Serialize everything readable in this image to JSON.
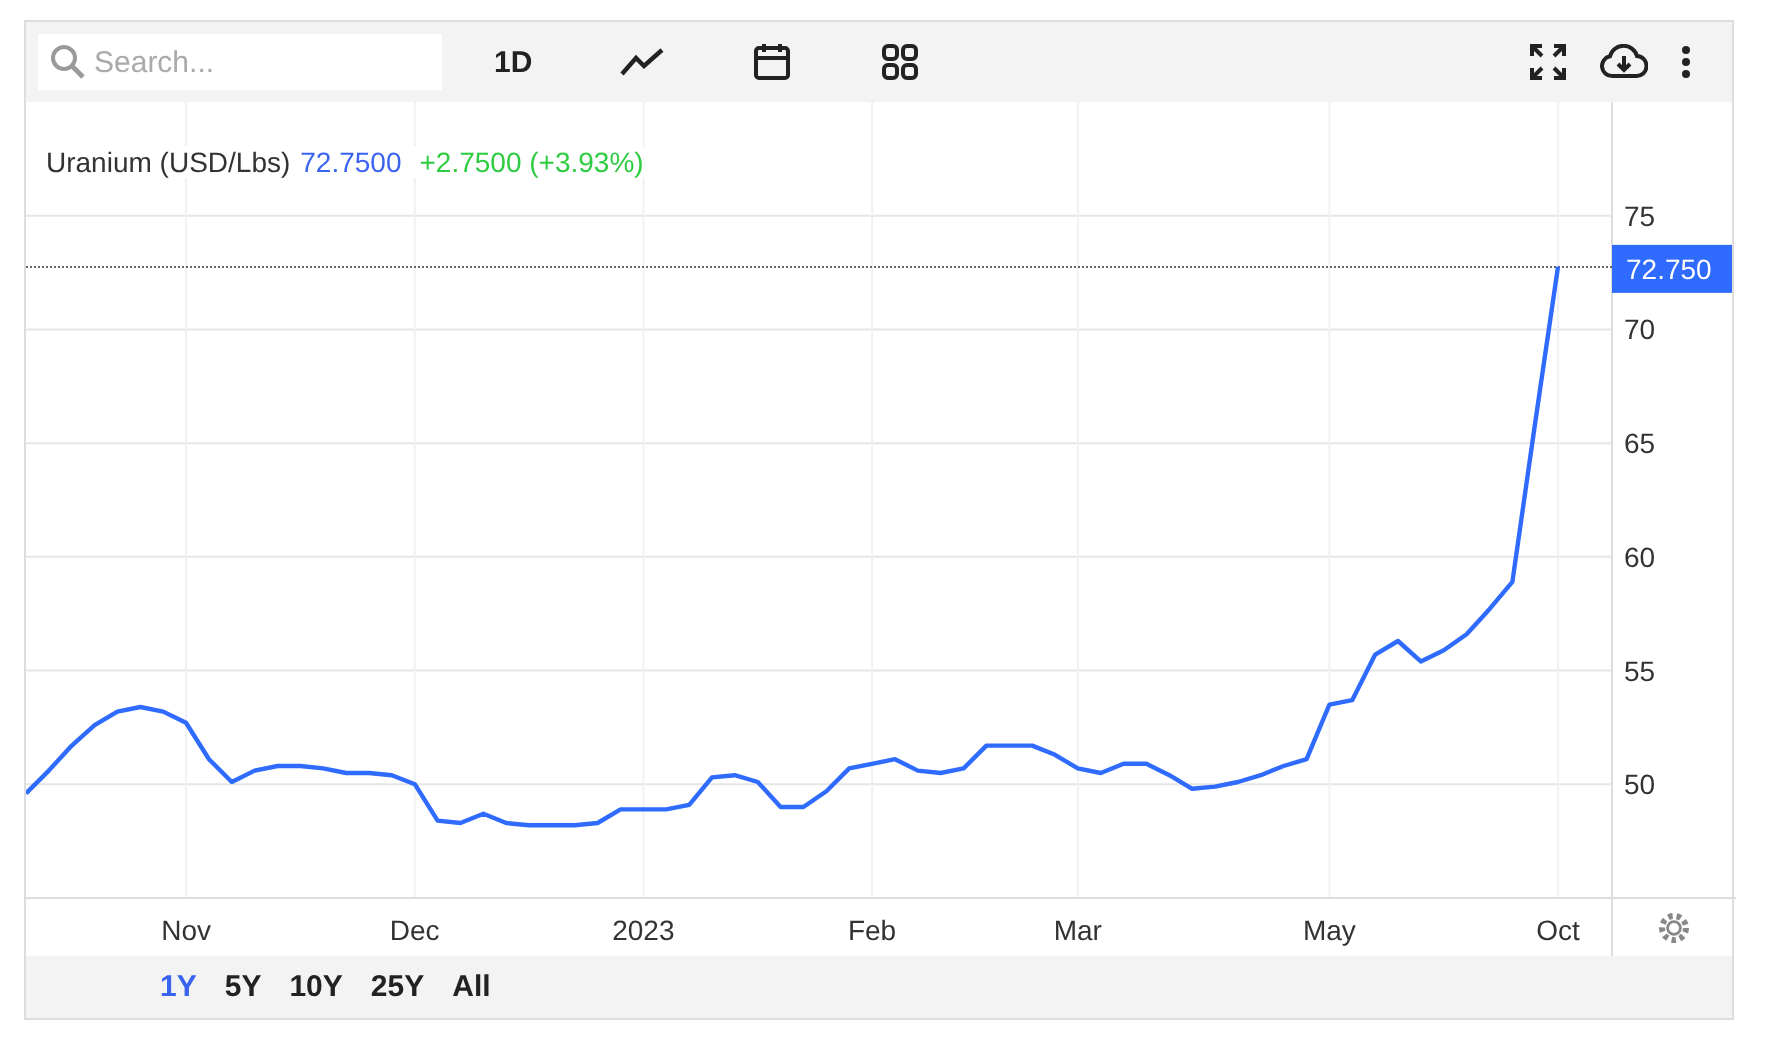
{
  "toolbar": {
    "search": {
      "placeholder": "Search..."
    },
    "interval": "1D"
  },
  "legend": {
    "name": "Uranium (USD/Lbs)",
    "price": "72.7500",
    "change": "+2.7500 (+3.93%)"
  },
  "chart": {
    "chart_data": {
      "type": "line",
      "grid": true,
      "ref_lines": [
        {
          "axis": "y",
          "value": 72.75,
          "label": "72.750"
        }
      ],
      "ylim": [
        45,
        80
      ],
      "yticks": [
        50,
        55,
        60,
        65,
        70,
        75
      ],
      "categories": [
        null,
        null,
        null,
        null,
        null,
        null,
        null,
        "Nov",
        null,
        null,
        null,
        null,
        null,
        null,
        null,
        null,
        null,
        "Dec",
        null,
        null,
        null,
        null,
        null,
        null,
        null,
        null,
        null,
        "2023",
        null,
        null,
        null,
        null,
        null,
        null,
        null,
        null,
        null,
        "Feb",
        null,
        null,
        null,
        null,
        null,
        null,
        null,
        null,
        "Mar",
        null,
        null,
        null,
        null,
        null,
        null,
        null,
        null,
        null,
        null,
        "May",
        null,
        null,
        null,
        null,
        null,
        null,
        null,
        null,
        null,
        "Oct"
      ],
      "series": [
        {
          "color": "#2f6bff",
          "values": [
            49.6,
            50.6,
            51.7,
            52.6,
            53.2,
            53.4,
            53.2,
            52.7,
            51.1,
            50.1,
            50.6,
            50.8,
            50.8,
            50.7,
            50.5,
            50.5,
            50.4,
            50.0,
            48.4,
            48.3,
            48.7,
            48.3,
            48.2,
            48.2,
            48.2,
            48.3,
            48.9,
            48.9,
            48.9,
            49.1,
            50.3,
            50.4,
            50.1,
            49.0,
            49.0,
            49.7,
            50.7,
            50.9,
            51.1,
            50.6,
            50.5,
            50.7,
            51.7,
            51.7,
            51.7,
            51.3,
            50.7,
            50.5,
            50.9,
            50.9,
            50.4,
            49.8,
            49.9,
            50.1,
            50.4,
            50.8,
            51.1,
            53.5,
            53.7,
            55.7,
            56.3,
            55.4,
            55.9,
            56.6,
            57.7,
            58.9,
            65.9,
            72.75
          ]
        }
      ]
    }
  },
  "ranges": [
    {
      "label": "1Y",
      "selected": true
    },
    {
      "label": "5Y",
      "selected": false
    },
    {
      "label": "10Y",
      "selected": false
    },
    {
      "label": "25Y",
      "selected": false
    },
    {
      "label": "All",
      "selected": false
    }
  ]
}
